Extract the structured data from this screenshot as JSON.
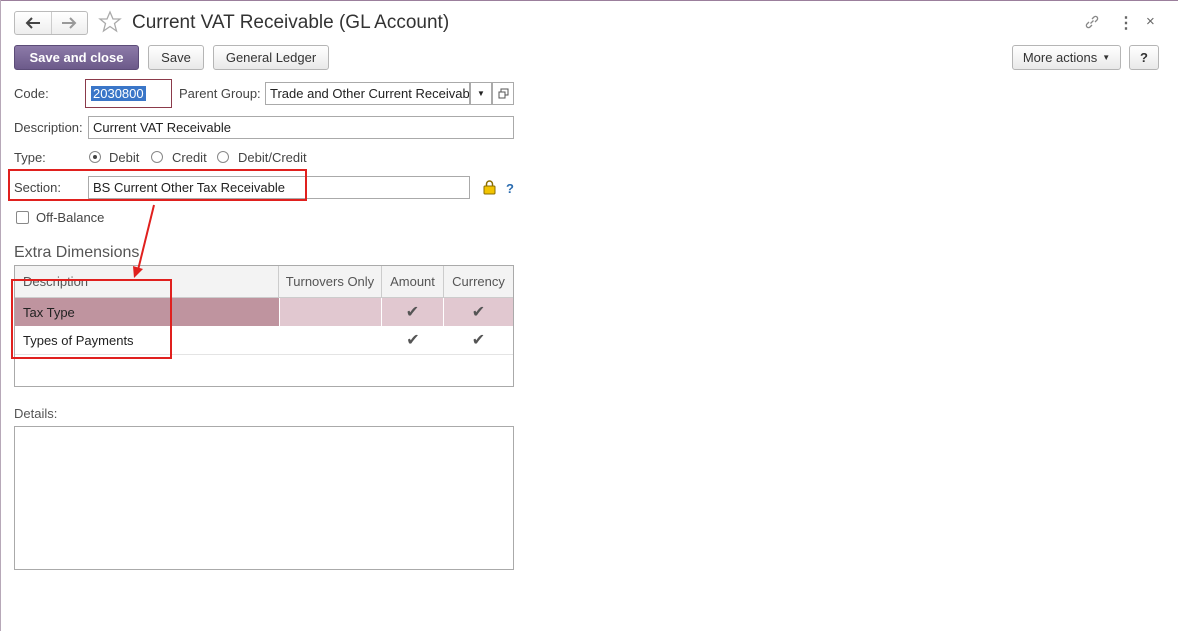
{
  "header": {
    "title": "Current VAT Receivable (GL Account)"
  },
  "toolbar": {
    "save_and_close": "Save and close",
    "save": "Save",
    "general_ledger": "General Ledger",
    "more_actions": "More actions",
    "help": "?"
  },
  "form": {
    "code_label": "Code:",
    "code_value": "2030800",
    "parent_group_label": "Parent Group:",
    "parent_group_value": "Trade and Other Current Receivabl",
    "description_label": "Description:",
    "description_value": "Current VAT Receivable",
    "type_label": "Type:",
    "type_options": [
      "Debit",
      "Credit",
      "Debit/Credit"
    ],
    "type_selected": "Debit",
    "section_label": "Section:",
    "section_value": "BS Current Other Tax Receivable",
    "section_help": "?",
    "off_balance_label": "Off-Balance"
  },
  "extra_dimensions": {
    "title": "Extra Dimensions",
    "columns": [
      "Description",
      "Turnovers Only",
      "Amount",
      "Currency"
    ],
    "rows": [
      {
        "description": "Tax Type",
        "turnovers_only": false,
        "amount": true,
        "currency": true
      },
      {
        "description": "Types of Payments",
        "turnovers_only": false,
        "amount": true,
        "currency": true
      }
    ]
  },
  "details": {
    "label": "Details:"
  },
  "colors": {
    "accent": "#7a6898",
    "selected_row": "#bf949f",
    "annotation": "#e0201e"
  }
}
